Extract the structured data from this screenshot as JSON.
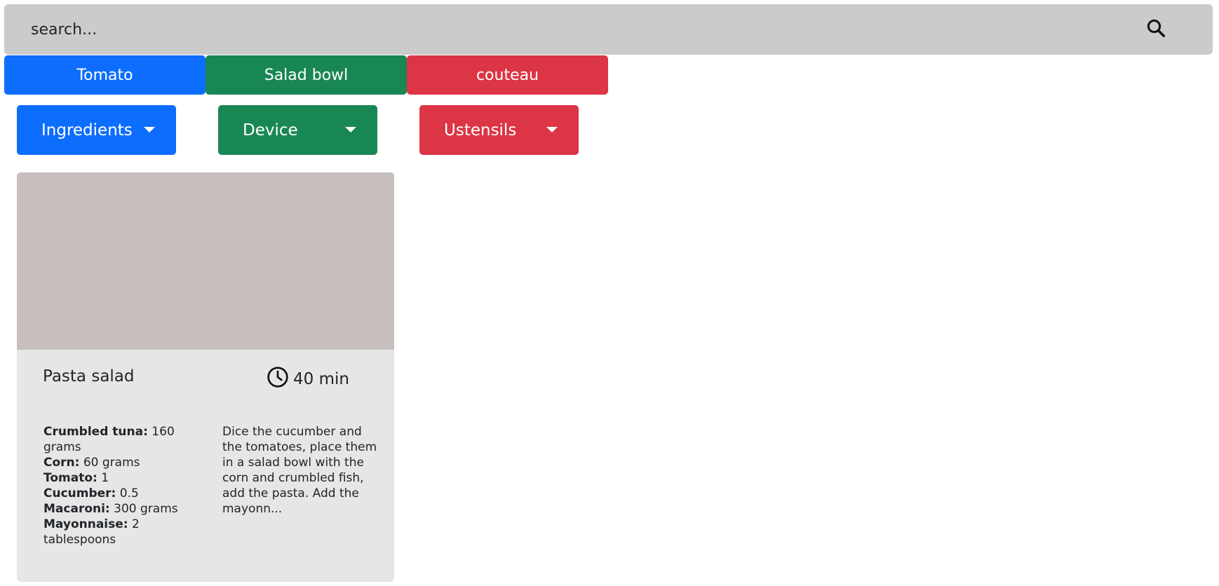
{
  "search": {
    "placeholder": "search..."
  },
  "tags": [
    {
      "label": "Tomato",
      "color": "#0d6efd"
    },
    {
      "label": "Salad bowl",
      "color": "#198754"
    },
    {
      "label": "couteau",
      "color": "#dc3545"
    }
  ],
  "filters": [
    {
      "label": "Ingredients",
      "color": "#0d6efd"
    },
    {
      "label": "Device",
      "color": "#198754"
    },
    {
      "label": "Ustensils",
      "color": "#dc3545"
    }
  ],
  "recipe": {
    "title": "Pasta salad",
    "time": "40 min",
    "ingredients": [
      {
        "name": "Crumbled tuna:",
        "quantity": " 160 grams"
      },
      {
        "name": "Corn:",
        "quantity": " 60 grams"
      },
      {
        "name": "Tomato:",
        "quantity": " 1"
      },
      {
        "name": "Cucumber:",
        "quantity": " 0.5"
      },
      {
        "name": "Macaroni:",
        "quantity": " 300 grams"
      },
      {
        "name": "Mayonnaise:",
        "quantity": " 2 tablespoons"
      }
    ],
    "description": "Dice the cucumber and the tomatoes, place them in a salad bowl with the corn and crumbled fish, add the pasta. Add the mayonn..."
  },
  "colors": {
    "search_bg": "#cbcbcb",
    "card_bg": "#e6e6e6",
    "card_image": "#c7bfbd"
  }
}
